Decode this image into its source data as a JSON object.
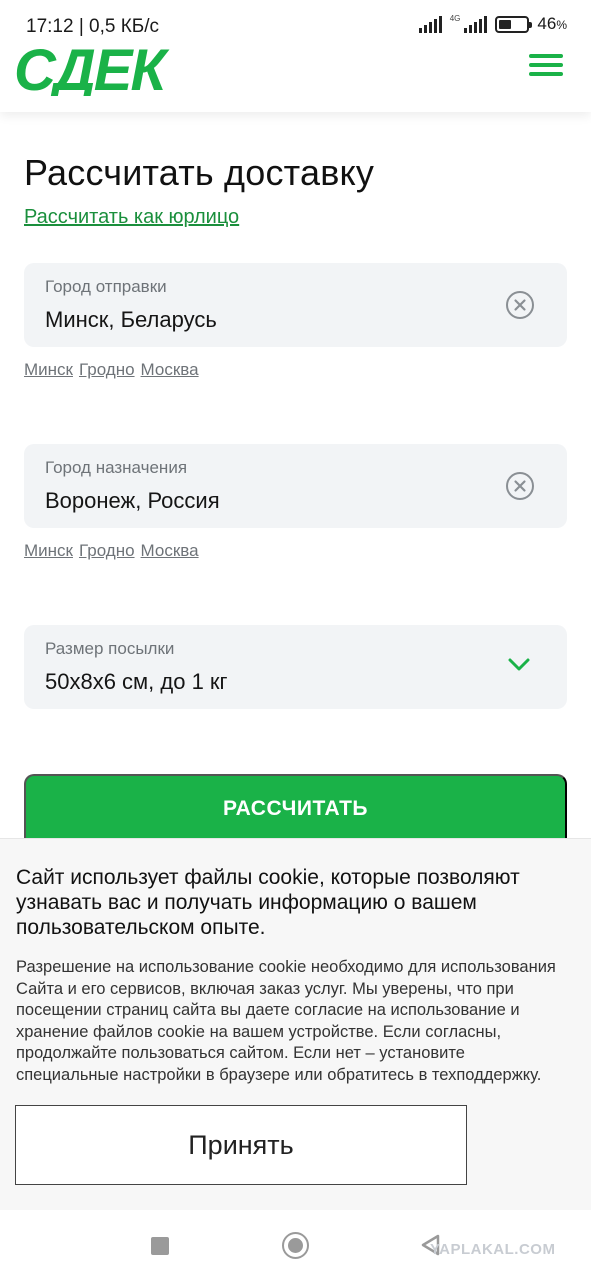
{
  "status_bar": {
    "time_speed": "17:12 | 0,5 КБ/с",
    "network_type": "4G",
    "battery_percent": "46",
    "battery_unit": "%",
    "battery_level": 0.46
  },
  "header": {
    "logo_text": "СДЕК",
    "brand_color": "#1ab248",
    "menu_icon": "hamburger-menu-icon"
  },
  "main": {
    "title": "Рассчитать доставку",
    "legal_link": "Рассчитать как юрлицо",
    "origin": {
      "label": "Город отправки",
      "value": "Минск, Беларусь",
      "quick_cities": [
        "Минск",
        "Гродно",
        "Москва"
      ]
    },
    "destination": {
      "label": "Город назначения",
      "value": "Воронеж, Россия",
      "quick_cities": [
        "Минск",
        "Гродно",
        "Москва"
      ]
    },
    "parcel": {
      "label": "Размер посылки",
      "value": "50х8х6 см, до 1 кг"
    },
    "calculate_label": "РАССЧИТАТЬ"
  },
  "cookie_banner": {
    "title": "Сайт использует файлы cookie, которые позволяют узнавать вас и получать информацию о вашем пользовательском опыте.",
    "text": "Разрешение на использование cookie необходимо для использования Сайта и его сервисов, включая заказ услуг. Мы уверены, что при посещении страниц сайта вы даете согласие на использование и хранение файлов cookie на вашем устройстве. Если согласны, продолжайте пользоваться сайтом. Если нет – установите специальные настройки в браузере или обратитесь в техподдержку.",
    "accept_label": "Принять"
  },
  "navbar": {
    "watermark": "YAPLAKAL.COM"
  }
}
